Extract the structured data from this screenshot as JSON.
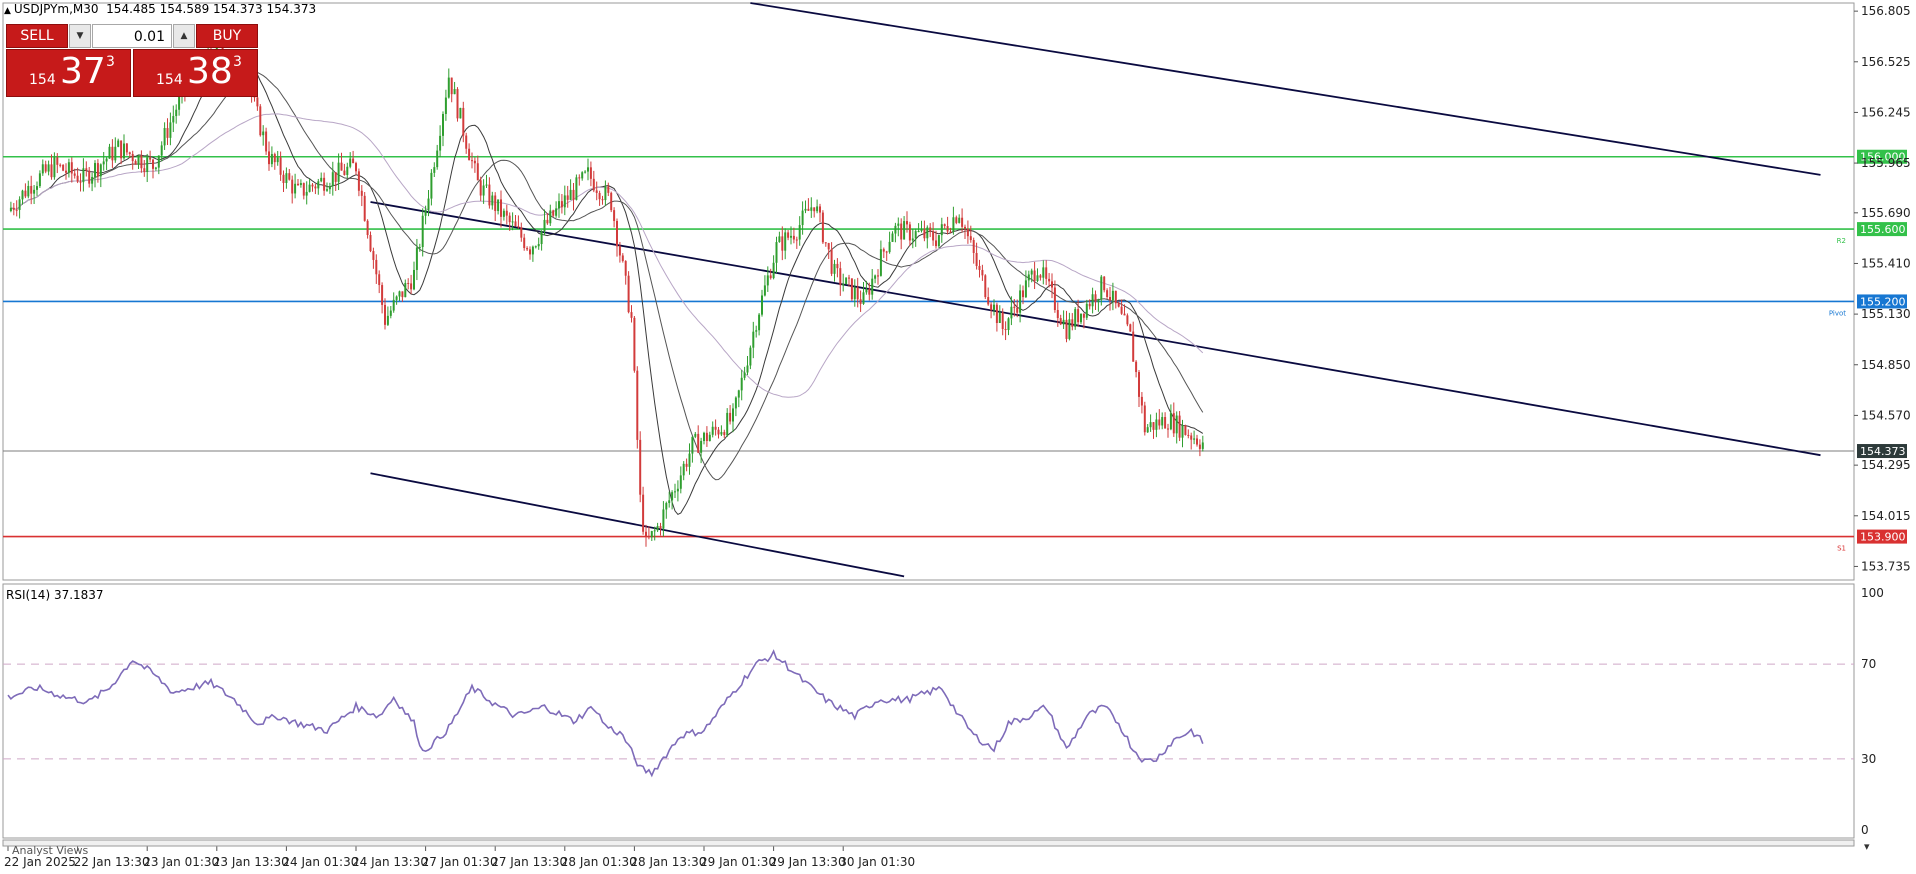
{
  "header": {
    "symbol_timeframe": "USDJPYm,M30",
    "ohlc": "154.485 154.589 154.373 154.373"
  },
  "trade_panel": {
    "sell_label": "SELL",
    "buy_label": "BUY",
    "lot_value": "0.01",
    "sell_price": {
      "prefix": "154",
      "main": "37",
      "sup": "3"
    },
    "buy_price": {
      "prefix": "154",
      "main": "38",
      "sup": "3"
    }
  },
  "indicator_label": "RSI(14) 37.1837",
  "bottom_tab": "Analyst Views",
  "chart_data": {
    "type": "candlestick",
    "symbol": "USDJPYm",
    "timeframe": "M30",
    "price_axis": {
      "ticks": [
        "156.805",
        "156.525",
        "156.245",
        "155.965",
        "155.690",
        "155.410",
        "155.130",
        "154.850",
        "154.570",
        "154.295",
        "154.015",
        "153.735"
      ],
      "range": [
        153.66,
        156.85
      ]
    },
    "time_axis": {
      "labels": [
        "22 Jan 2025",
        "22 Jan 13:30",
        "23 Jan 01:30",
        "23 Jan 13:30",
        "24 Jan 01:30",
        "24 Jan 13:30",
        "27 Jan 01:30",
        "27 Jan 13:30",
        "28 Jan 01:30",
        "28 Jan 13:30",
        "29 Jan 01:30",
        "29 Jan 13:30",
        "30 Jan 01:30"
      ],
      "bars_per_label": 24,
      "total_bars": 330
    },
    "price_path": [
      [
        0,
        155.7
      ],
      [
        8,
        155.85
      ],
      [
        16,
        155.95
      ],
      [
        26,
        155.88
      ],
      [
        38,
        156.05
      ],
      [
        50,
        155.95
      ],
      [
        60,
        156.35
      ],
      [
        72,
        156.6
      ],
      [
        82,
        156.45
      ],
      [
        90,
        156.0
      ],
      [
        100,
        155.8
      ],
      [
        110,
        155.88
      ],
      [
        120,
        155.95
      ],
      [
        130,
        155.1
      ],
      [
        140,
        155.35
      ],
      [
        152,
        156.45
      ],
      [
        162,
        155.85
      ],
      [
        172,
        155.65
      ],
      [
        180,
        155.5
      ],
      [
        190,
        155.72
      ],
      [
        200,
        155.9
      ],
      [
        208,
        155.75
      ],
      [
        215,
        155.1
      ],
      [
        218,
        154.1
      ],
      [
        220,
        153.85
      ],
      [
        224,
        153.95
      ],
      [
        236,
        154.4
      ],
      [
        250,
        154.55
      ],
      [
        258,
        155.1
      ],
      [
        265,
        155.5
      ],
      [
        272,
        155.6
      ],
      [
        278,
        155.75
      ],
      [
        285,
        155.35
      ],
      [
        295,
        155.2
      ],
      [
        305,
        155.6
      ],
      [
        320,
        155.55
      ],
      [
        328,
        155.7
      ],
      [
        335,
        155.35
      ],
      [
        343,
        155.05
      ],
      [
        355,
        155.4
      ],
      [
        365,
        155.05
      ],
      [
        378,
        155.3
      ],
      [
        387,
        155.0
      ],
      [
        392,
        154.5
      ],
      [
        400,
        154.55
      ],
      [
        412,
        154.42
      ]
    ],
    "rsi": {
      "name": "RSI(14)",
      "current": 37.1837,
      "levels": [
        30,
        70
      ],
      "ticks": [
        "100",
        "70",
        "30",
        "0"
      ],
      "path": [
        [
          0,
          56
        ],
        [
          10,
          60
        ],
        [
          20,
          56
        ],
        [
          28,
          54
        ],
        [
          35,
          60
        ],
        [
          43,
          72
        ],
        [
          50,
          66
        ],
        [
          57,
          58
        ],
        [
          63,
          60
        ],
        [
          70,
          62
        ],
        [
          78,
          55
        ],
        [
          86,
          45
        ],
        [
          93,
          48
        ],
        [
          100,
          45
        ],
        [
          110,
          42
        ],
        [
          120,
          52
        ],
        [
          128,
          48
        ],
        [
          133,
          56
        ],
        [
          140,
          45
        ],
        [
          143,
          33
        ],
        [
          148,
          38
        ],
        [
          152,
          43
        ],
        [
          160,
          60
        ],
        [
          168,
          53
        ],
        [
          175,
          48
        ],
        [
          185,
          52
        ],
        [
          195,
          46
        ],
        [
          202,
          52
        ],
        [
          206,
          44
        ],
        [
          212,
          40
        ],
        [
          218,
          26
        ],
        [
          222,
          24
        ],
        [
          232,
          40
        ],
        [
          240,
          42
        ],
        [
          250,
          58
        ],
        [
          258,
          70
        ],
        [
          264,
          74
        ],
        [
          268,
          70
        ],
        [
          275,
          62
        ],
        [
          283,
          54
        ],
        [
          292,
          48
        ],
        [
          300,
          55
        ],
        [
          310,
          55
        ],
        [
          322,
          60
        ],
        [
          327,
          50
        ],
        [
          333,
          40
        ],
        [
          340,
          34
        ],
        [
          345,
          45
        ],
        [
          352,
          48
        ],
        [
          358,
          52
        ],
        [
          365,
          34
        ],
        [
          372,
          48
        ],
        [
          378,
          52
        ],
        [
          383,
          45
        ],
        [
          388,
          34
        ],
        [
          392,
          29
        ],
        [
          396,
          30
        ],
        [
          402,
          38
        ],
        [
          408,
          42
        ],
        [
          412,
          37
        ]
      ]
    },
    "horizontal_levels": [
      {
        "price": 156.0,
        "label": "156.000",
        "color": "#33c14a",
        "tag": ""
      },
      {
        "price": 155.6,
        "label": "155.600",
        "color": "#33c14a",
        "tag": "R2"
      },
      {
        "price": 155.2,
        "label": "155.200",
        "color": "#1777d2",
        "tag": "Pivot"
      },
      {
        "price": 154.373,
        "label": "154.373",
        "color": "#7c7c7c",
        "tag": ""
      },
      {
        "price": 153.9,
        "label": "153.900",
        "color": "#d93131",
        "tag": "S1"
      }
    ],
    "trend_lines": [
      {
        "from": [
          256,
          156.85
        ],
        "to": [
          625,
          155.9
        ]
      },
      {
        "from": [
          125,
          155.75
        ],
        "to": [
          625,
          154.35
        ]
      },
      {
        "from": [
          125,
          154.25
        ],
        "to": [
          309,
          153.68
        ]
      }
    ],
    "moving_averages": [
      {
        "color": "#3a3a3a"
      },
      {
        "color": "#555555"
      },
      {
        "color": "#b8a6c6"
      }
    ],
    "colors": {
      "bull": "#2f9e2f",
      "bear": "#d23b3b",
      "rsi_line": "#7e6bb9",
      "level_dash": "#cfa8c8",
      "trend": "#0a0a40"
    }
  }
}
